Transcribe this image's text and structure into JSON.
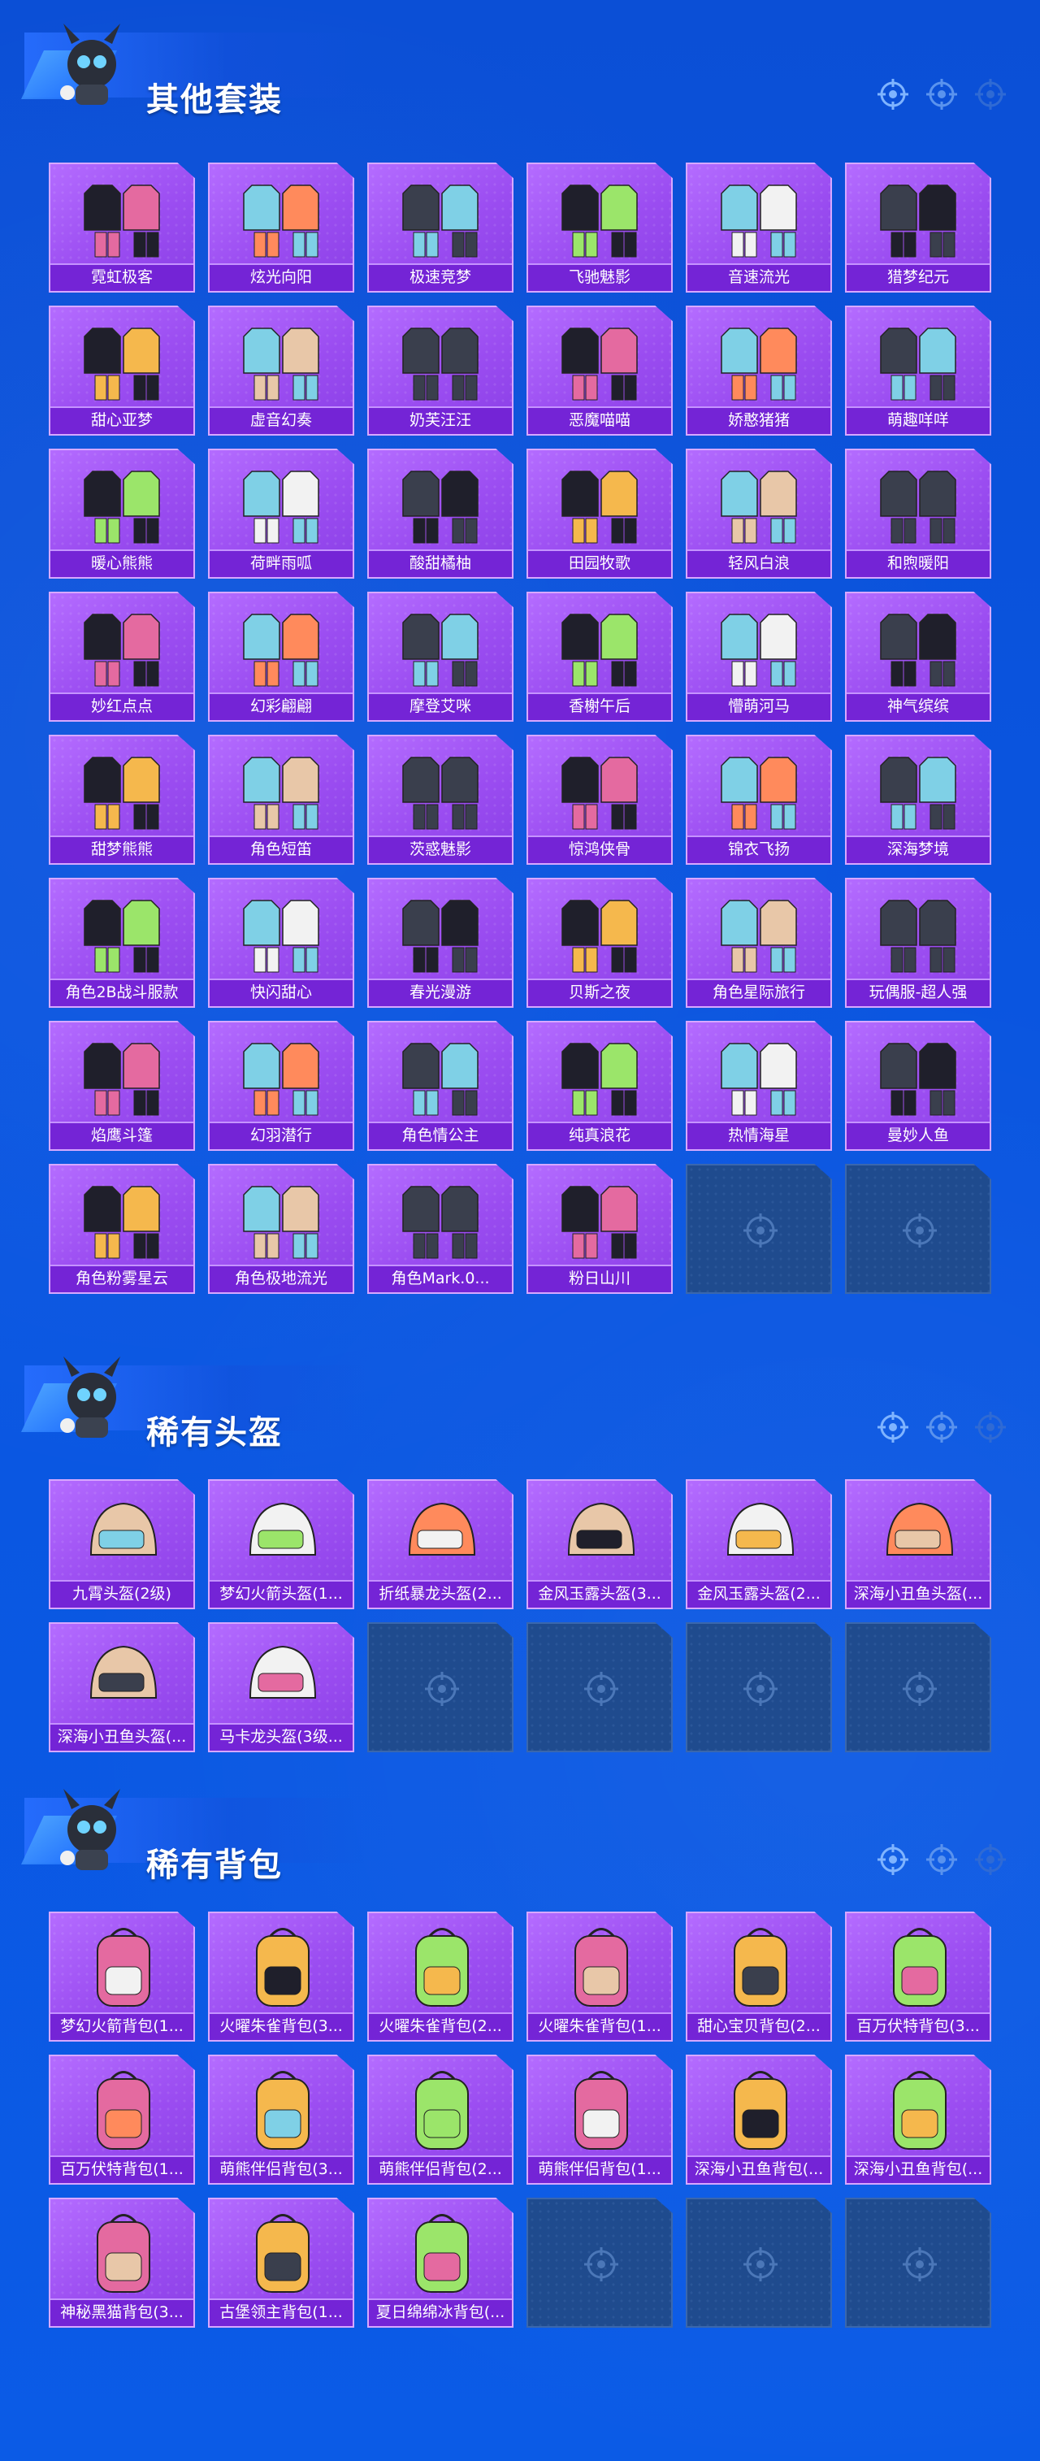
{
  "sections": [
    {
      "title": "其他套装",
      "items": [
        "霓虹极客",
        "炫光向阳",
        "极速竞梦",
        "飞驰魅影",
        "音速流光",
        "猎梦纪元",
        "甜心亚梦",
        "虚音幻奏",
        "奶芙汪汪",
        "恶魔喵喵",
        "娇憨猪猪",
        "萌趣咩咩",
        "暖心熊熊",
        "荷畔雨呱",
        "酸甜橘柚",
        "田园牧歌",
        "轻风白浪",
        "和煦暖阳",
        "妙红点点",
        "幻彩翩翩",
        "摩登艾咪",
        "香榭午后",
        "懵萌河马",
        "神气缤缤",
        "甜梦熊熊",
        "角色短笛",
        "茨惑魅影",
        "惊鸿侠骨",
        "锦衣飞扬",
        "深海梦境",
        "角色2B战斗服款",
        "快闪甜心",
        "春光漫游",
        "贝斯之夜",
        "角色星际旅行",
        "玩偶服-超人强",
        "焰鹰斗篷",
        "幻羽潜行",
        "角色情公主",
        "纯真浪花",
        "热情海星",
        "曼妙人鱼",
        "角色粉雾星云",
        "角色极地流光",
        "角色Mark.0...",
        "粉日山川",
        "",
        ""
      ]
    },
    {
      "title": "稀有头盔",
      "items": [
        "九霄头盔(2级)",
        "梦幻火箭头盔(1...",
        "折纸暴龙头盔(2...",
        "金风玉露头盔(3...",
        "金风玉露头盔(2...",
        "深海小丑鱼头盔(...",
        "深海小丑鱼头盔(...",
        "马卡龙头盔(3级...",
        "",
        "",
        "",
        ""
      ]
    },
    {
      "title": "稀有背包",
      "items": [
        "梦幻火箭背包(1...",
        "火曜朱雀背包(3...",
        "火曜朱雀背包(2...",
        "火曜朱雀背包(1...",
        "甜心宝贝背包(2...",
        "百万伏特背包(3...",
        "百万伏特背包(1...",
        "萌熊伴侣背包(3...",
        "萌熊伴侣背包(2...",
        "萌熊伴侣背包(1...",
        "深海小丑鱼背包(...",
        "深海小丑鱼背包(...",
        "神秘黑猫背包(3...",
        "古堡领主背包(1...",
        "夏日绵绵冰背包(...",
        "",
        "",
        ""
      ]
    }
  ]
}
